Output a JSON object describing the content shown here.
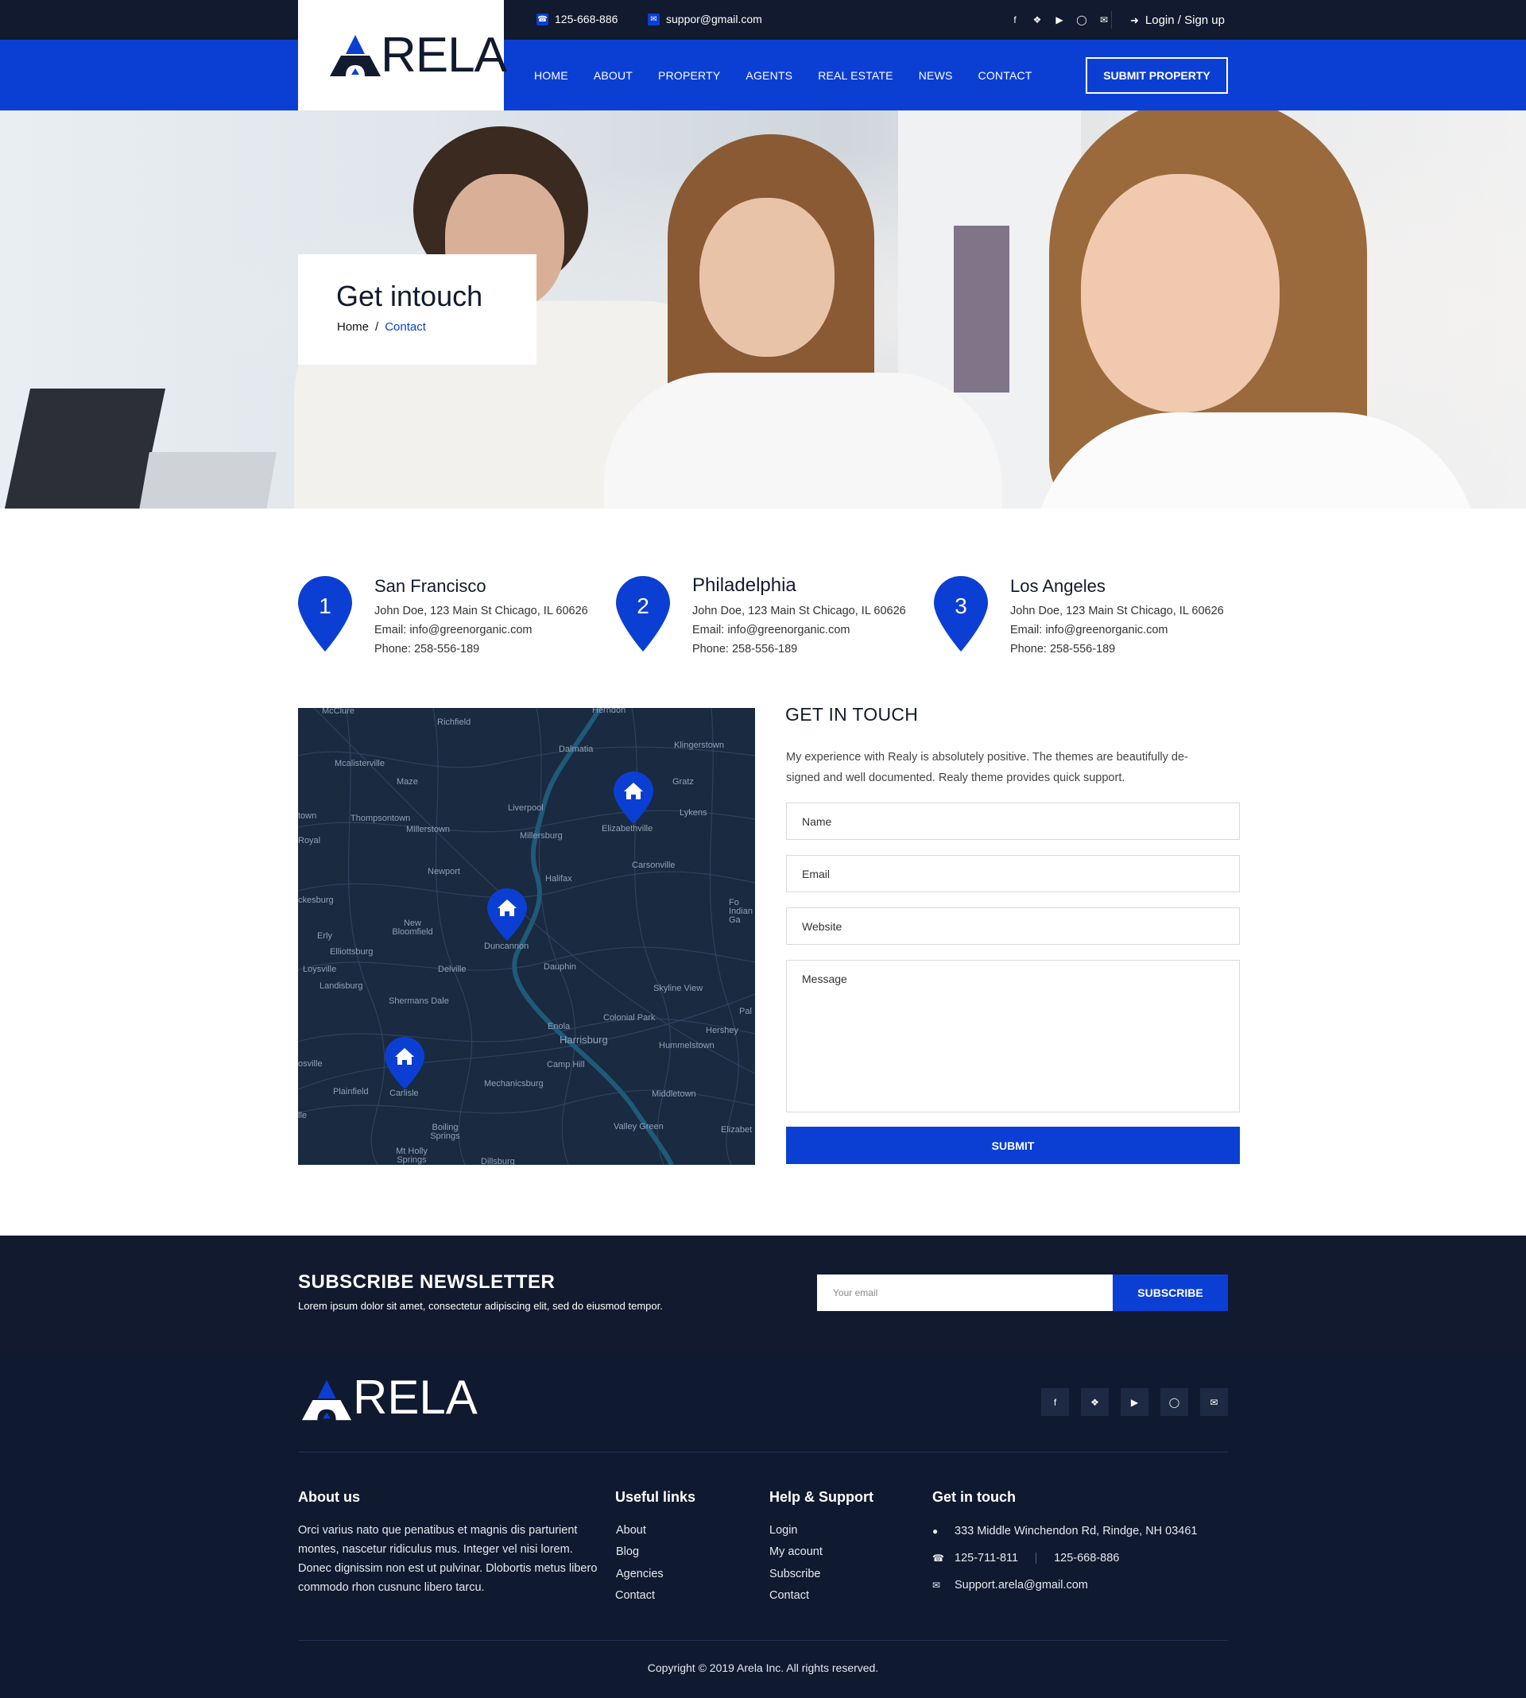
{
  "topbar": {
    "phone": "125-668-886",
    "email": "suppor@gmail.com",
    "social_icons": [
      "facebook-icon",
      "twitter-icon",
      "youtube-icon",
      "instagram-icon",
      "mail-icon"
    ],
    "login_label": "Login / Sign up"
  },
  "brand": {
    "logo_text": "RELA",
    "accent": "#0b3fd4",
    "dark": "#111a2e"
  },
  "nav": {
    "items": [
      "HOME",
      "ABOUT",
      "PROPERTY",
      "AGENTS",
      "REAL ESTATE",
      "NEWS",
      "CONTACT"
    ],
    "submit_label": "SUBMIT PROPERTY"
  },
  "hero": {
    "title": "Get intouch",
    "breadcrumb_home": "Home",
    "breadcrumb_sep": "/",
    "breadcrumb_current": "Contact"
  },
  "locations": [
    {
      "num": "1",
      "city": "San Francisco",
      "address": "John Doe, 123 Main St Chicago, IL 60626",
      "email": "Email: info@greenorganic.com",
      "phone": "Phone: 258-556-189"
    },
    {
      "num": "2",
      "city": "Philadelphia",
      "address": "John Doe, 123 Main St Chicago, IL 60626",
      "email": "Email: info@greenorganic.com",
      "phone": "Phone: 258-556-189"
    },
    {
      "num": "3",
      "city": "Los Angeles",
      "address": "John Doe, 123 Main St Chicago, IL 60626",
      "email": "Email: info@greenorganic.com",
      "phone": "Phone: 258-556-189"
    }
  ],
  "map": {
    "labels": [
      "McClure",
      "Richfield",
      "Herndon",
      "Dalmatia",
      "Klingerstown",
      "Mcalisterville",
      "Maze",
      "Gratz",
      "Lykens",
      "Liverpool",
      "Elizabethville",
      "Millersburg",
      "Thompsontown",
      "Millerstown",
      "Royal",
      "Newport",
      "Carsonville",
      "Halifax",
      "ckesburg",
      "New Bloomfield",
      "Erly",
      "Elliottsburg",
      "Duncannon",
      "Loysville",
      "Dauphin",
      "Delville",
      "Landisburg",
      "Skyline View",
      "Shermans Dale",
      "Enola",
      "Colonial Park",
      "Hershey",
      "Harrisburg",
      "Hummelstown",
      "Camp Hill",
      "Plainfield",
      "Carlisle",
      "Mechanicsburg",
      "Middletown",
      "Boiling Springs",
      "Valley Green",
      "Mt Holly Springs",
      "Dillsburg",
      "Elizabet",
      "town",
      "Fo Indian Ga",
      "Pal",
      "osville",
      "lle"
    ]
  },
  "form": {
    "title": "GET IN TOUCH",
    "description": "My experience with Realy is absolutely positive. The themes are beautifully de-signed and well documented. Realy theme provides quick support.",
    "name_placeholder": "Name",
    "email_placeholder": "Email",
    "website_placeholder": "Website",
    "message_placeholder": "Message",
    "submit_label": "SUBMIT"
  },
  "newsletter": {
    "title": "SUBSCRIBE NEWSLETTER",
    "subtitle": "Lorem ipsum dolor sit amet, consectetur adipiscing elit, sed do eiusmod tempor.",
    "placeholder": "Your email",
    "button": "SUBSCRIBE"
  },
  "footer": {
    "logo_text": "RELA",
    "about_title": "About us",
    "about_text": "Orci varius nato que penatibus et magnis dis parturient montes, nascetur ridiculus mus. Integer vel nisi lorem. Donec dignissim non est ut pulvinar. Dlobortis metus libero commodo rhon cusnunc libero tarcu.",
    "useful_title": "Useful links",
    "useful_links": [
      "About",
      "Blog",
      "Agencies",
      "Contact"
    ],
    "help_title": "Help & Support",
    "help_links": [
      "Login",
      "My acount",
      "Subscribe",
      "Contact"
    ],
    "contact_title": "Get in touch",
    "address": "333 Middle Winchendon Rd, Rindge, NH 03461",
    "phone1": "125-711-811",
    "phone2": "125-668-886",
    "email": "Support.arela@gmail.com",
    "copyright": "Copyright © 2019 Arela Inc. All rights reserved."
  }
}
